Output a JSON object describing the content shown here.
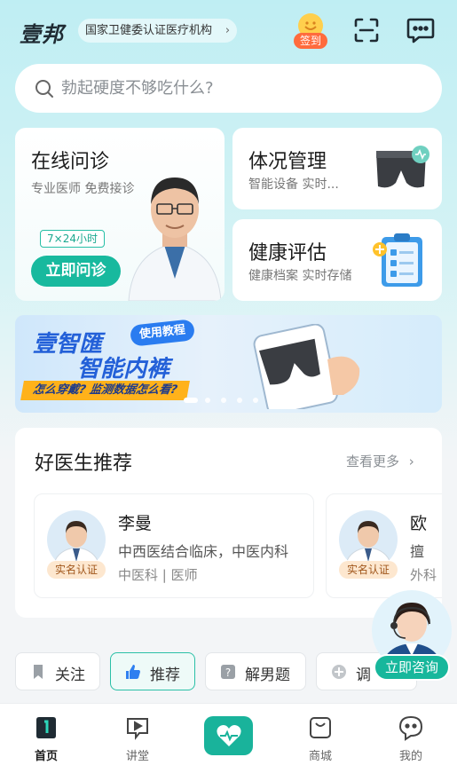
{
  "header": {
    "logo": "壹邦",
    "cert_label": "国家卫健委认证医疗机构",
    "signin_label": "签到"
  },
  "search": {
    "placeholder": "勃起硬度不够吃什么?"
  },
  "cards": {
    "consult": {
      "title": "在线问诊",
      "subtitle": "专业医师 免费接诊",
      "hours": "7×24小时",
      "button": "立即问诊"
    },
    "body": {
      "title": "体况管理",
      "subtitle": "智能设备 实时..."
    },
    "eval": {
      "title": "健康评估",
      "subtitle": "健康档案 实时存储"
    }
  },
  "banner": {
    "line1": "壹智匯",
    "line2": "智能内裤",
    "tag": "使用教程",
    "strip": "怎么穿戴? 监测数据怎么看?",
    "total_slides": 6,
    "active_slide": 1
  },
  "recommend": {
    "title": "好医生推荐",
    "more": "查看更多",
    "doctors": [
      {
        "name": "李曼",
        "specialty": "中西医结合临床，中医内科",
        "dept": "中医科 | 医师",
        "verify": "实名认证"
      },
      {
        "name": "欧",
        "specialty": "擅",
        "dept": "外科",
        "verify": "实名认证"
      }
    ]
  },
  "assistant": {
    "button": "立即咨询"
  },
  "chips": [
    {
      "label": "关注",
      "icon": "bookmark-icon"
    },
    {
      "label": "推荐",
      "icon": "thumb-up-icon",
      "active": true
    },
    {
      "label": "解男题",
      "icon": "question-icon"
    },
    {
      "label": "调",
      "icon": "drop-icon"
    }
  ],
  "nav": [
    {
      "label": "首页",
      "icon": "home-icon",
      "active": true
    },
    {
      "label": "讲堂",
      "icon": "play-icon"
    },
    {
      "label": "",
      "icon": "heart-pulse-icon"
    },
    {
      "label": "商城",
      "icon": "bag-icon"
    },
    {
      "label": "我的",
      "icon": "face-icon"
    }
  ],
  "colors": {
    "primary": "#18b99e",
    "banner_blue": "#2360d8",
    "accent_orange": "#ff6b3d"
  }
}
